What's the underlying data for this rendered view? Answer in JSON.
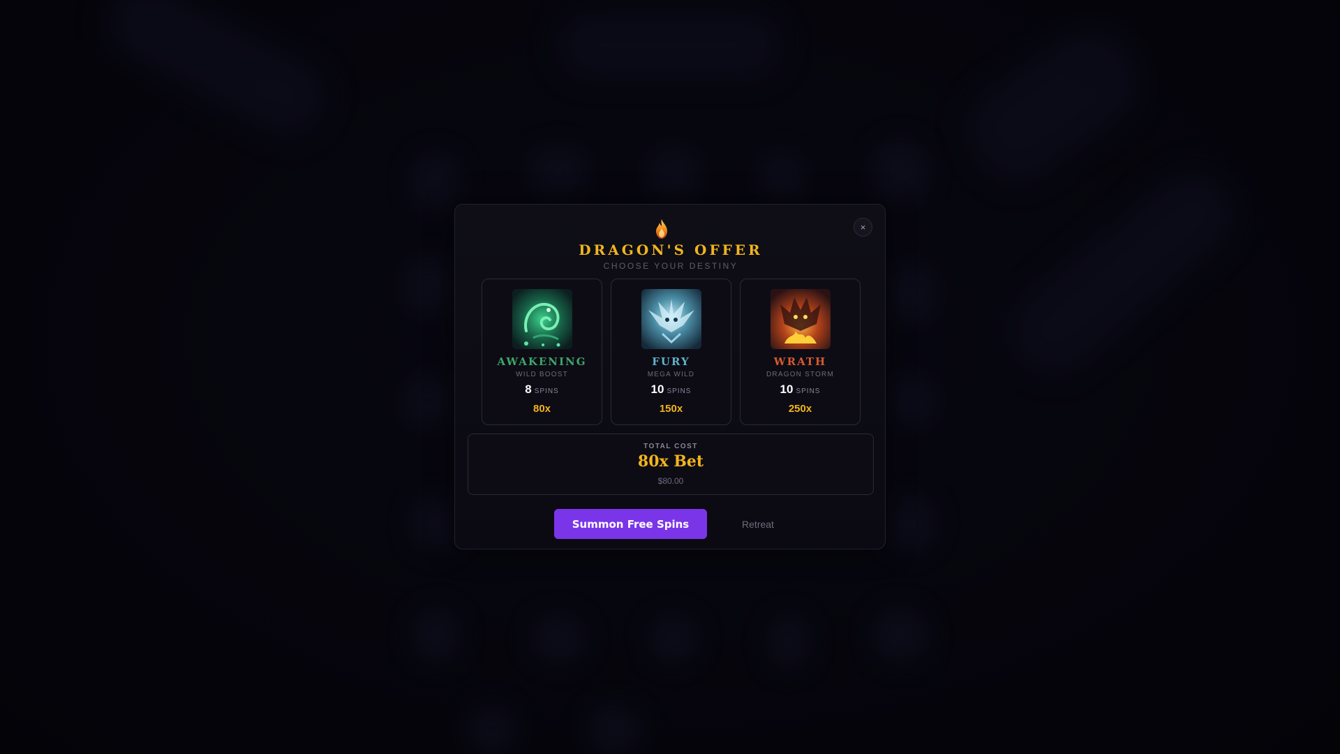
{
  "dialog": {
    "title": "DRAGON'S OFFER",
    "subtitle": "CHOOSE YOUR DESTINY",
    "close_icon": "×"
  },
  "options": [
    {
      "name": "AWAKENING",
      "subtitle": "WILD BOOST",
      "spins": "8",
      "spins_unit": "SPINS",
      "multiplier": "80x",
      "name_color": "#3fa66b",
      "art": "green-dragon-art"
    },
    {
      "name": "FURY",
      "subtitle": "MEGA WILD",
      "spins": "10",
      "spins_unit": "SPINS",
      "multiplier": "150x",
      "name_color": "#5fb4c8",
      "art": "ice-dragon-art"
    },
    {
      "name": "WRATH",
      "subtitle": "DRAGON STORM",
      "spins": "10",
      "spins_unit": "SPINS",
      "multiplier": "250x",
      "name_color": "#d85a2e",
      "art": "fire-dragon-art"
    }
  ],
  "cost": {
    "label": "TOTAL COST",
    "value": "80x Bet",
    "amount": "$80.00"
  },
  "actions": {
    "summon_label": "Summon Free Spins",
    "retreat_label": "Retreat"
  },
  "colors": {
    "accent_gold": "#f2b51d",
    "primary_button": "#7b35e8"
  }
}
